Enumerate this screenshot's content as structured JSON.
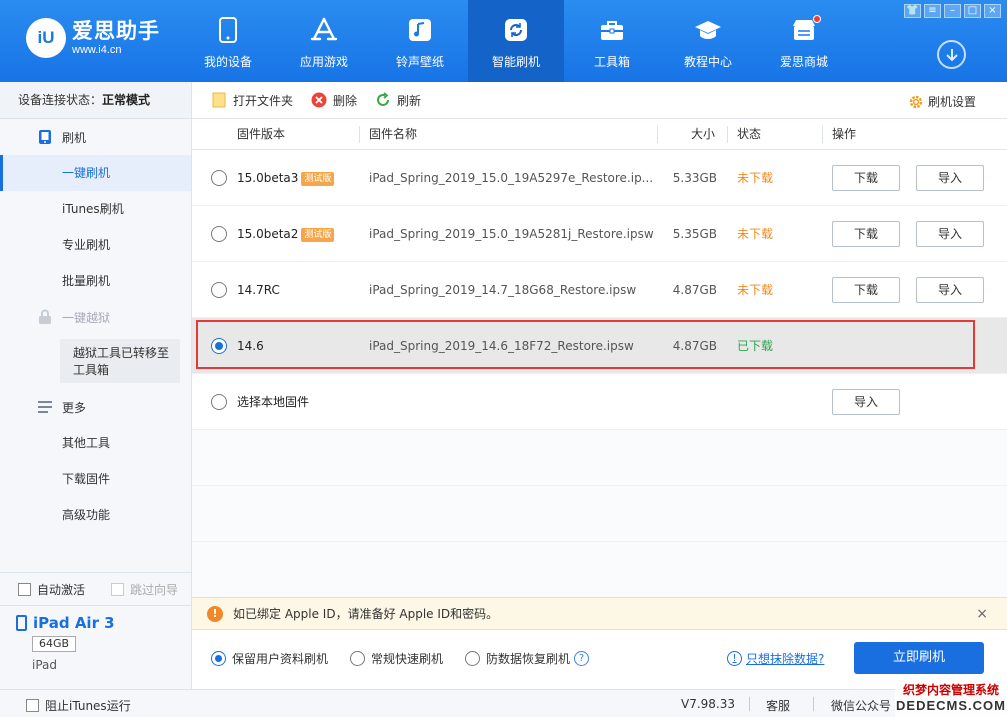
{
  "app": {
    "logo_mark": "iU",
    "logo_title": "爱思助手",
    "logo_url": "www.i4.cn"
  },
  "nav": [
    {
      "label": "我的设备",
      "icon": "phone-icon",
      "active": false
    },
    {
      "label": "应用游戏",
      "icon": "app-store-icon",
      "active": false
    },
    {
      "label": "铃声壁纸",
      "icon": "music-icon",
      "active": false
    },
    {
      "label": "智能刷机",
      "icon": "refresh-icon",
      "active": true
    },
    {
      "label": "工具箱",
      "icon": "toolbox-icon",
      "active": false
    },
    {
      "label": "教程中心",
      "icon": "graduation-cap-icon",
      "active": false
    },
    {
      "label": "爱思商城",
      "icon": "shop-icon",
      "active": false
    }
  ],
  "colors": {
    "header_blue": "#1a78e8",
    "accent": "#1a6fe0",
    "pending": "#f08a1c",
    "done": "#2ea44f",
    "highlight_border": "#e53935"
  },
  "sidebar": {
    "status_label": "设备连接状态：",
    "status_value": "正常模式",
    "groups": {
      "flash": "刷机",
      "jailbreak": "一键越狱",
      "more": "更多"
    },
    "flash_items": [
      "一键刷机",
      "iTunes刷机",
      "专业刷机",
      "批量刷机"
    ],
    "jailbreak_note": "越狱工具已转移至工具箱",
    "more_items": [
      "其他工具",
      "下载固件",
      "高级功能"
    ],
    "auto_activate": "自动激活",
    "skip_guide": "跳过向导",
    "device_name": "iPad Air 3",
    "device_capacity": "64GB",
    "device_type": "iPad"
  },
  "toolbar": {
    "open_folder": "打开文件夹",
    "delete": "删除",
    "refresh": "刷新",
    "settings": "刷机设置"
  },
  "table": {
    "headers": {
      "version": "固件版本",
      "name": "固件名称",
      "size": "大小",
      "status": "状态",
      "action": "操作"
    },
    "rows": [
      {
        "version": "15.0beta3",
        "badge": "测试版",
        "name": "iPad_Spring_2019_15.0_19A5297e_Restore.ip...",
        "size": "5.33GB",
        "status": "未下载",
        "btn1": "下载",
        "btn2": "导入"
      },
      {
        "version": "15.0beta2",
        "badge": "测试版",
        "name": "iPad_Spring_2019_15.0_19A5281j_Restore.ipsw",
        "size": "5.35GB",
        "status": "未下载",
        "btn1": "下载",
        "btn2": "导入"
      },
      {
        "version": "14.7RC",
        "badge": "",
        "name": "iPad_Spring_2019_14.7_18G68_Restore.ipsw",
        "size": "4.87GB",
        "status": "未下载",
        "btn1": "下载",
        "btn2": "导入"
      },
      {
        "version": "14.6",
        "badge": "",
        "name": "iPad_Spring_2019_14.6_18F72_Restore.ipsw",
        "size": "4.87GB",
        "status": "已下载",
        "btn1": "",
        "btn2": ""
      }
    ],
    "local_label": "选择本地固件",
    "local_import": "导入"
  },
  "notice": {
    "icon": "!",
    "text": "如已绑定 Apple ID，请准备好 Apple ID和密码。",
    "close": "×"
  },
  "options": {
    "keep_data": "保留用户资料刷机",
    "quick": "常规快速刷机",
    "anti_recovery": "防数据恢复刷机",
    "help": "?",
    "erase_icon": "!",
    "erase_link": "只想抹除数据?",
    "flash_now": "立即刷机"
  },
  "statusbar": {
    "itunes": "阻止iTunes运行",
    "version": "V7.98.33",
    "service": "客服",
    "wechat": "微信公众号"
  },
  "watermark": {
    "line1": "织梦内容管理系统",
    "line2": "DEDECMS.COM"
  }
}
